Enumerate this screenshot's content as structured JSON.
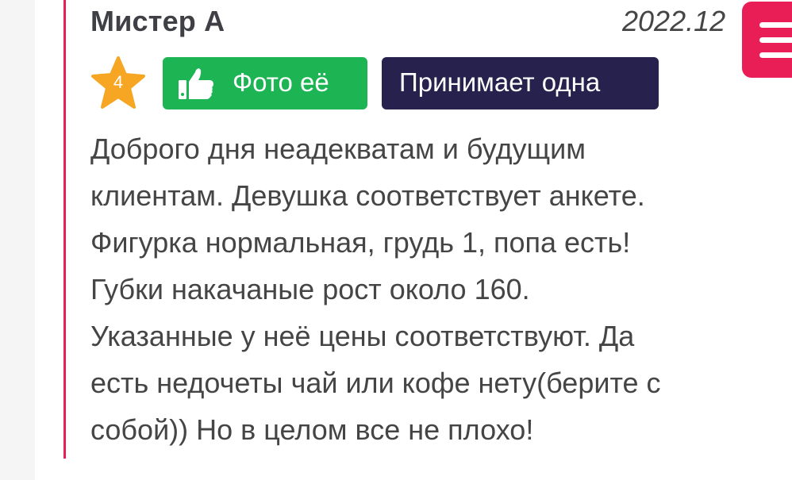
{
  "review": {
    "author": "Мистер А",
    "date": "2022.12",
    "rating": "4",
    "photo_badge": "Фото её",
    "accept_badge": "Принимает одна",
    "text_lines": [
      "Доброго дня неадекватам и будущим",
      "клиентам. Девушка соответствует анкете.",
      "Фигурка нормальная, грудь 1, попа есть!",
      "Губки накачаные рост около 160.",
      "Указанные у неё цены соответствуют. Да",
      "есть недочеты чай или кофе нету(берите с",
      "собой)) Но в целом все не плохо!"
    ]
  },
  "icons": {
    "rating": "star-icon",
    "photo": "thumbs-up-icon",
    "menu": "hamburger-menu-icon"
  },
  "colors": {
    "accent": "#e91e56",
    "green": "#1db554",
    "navy": "#27214d",
    "star": "#f6a623",
    "text": "#454545"
  }
}
